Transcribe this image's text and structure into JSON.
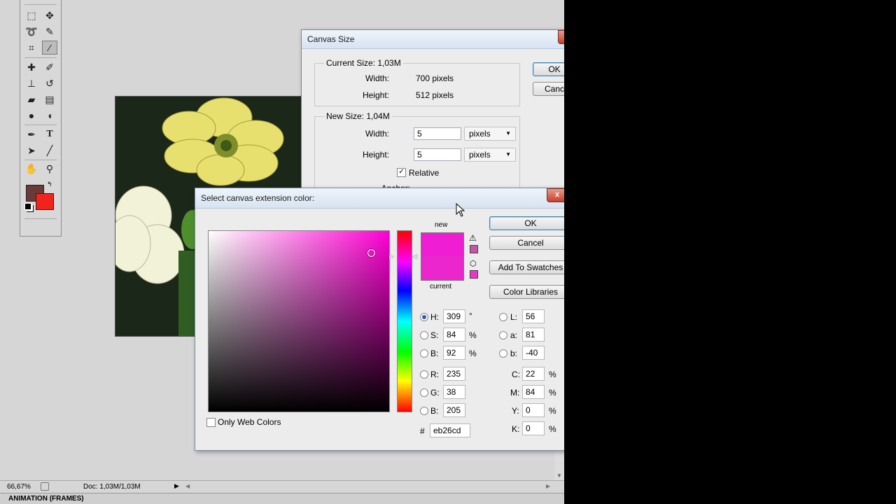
{
  "toolbox": {
    "tools": [
      "marquee-icon",
      "move-icon",
      "lasso-icon",
      "quick-selection-icon",
      "crop-icon",
      "eyedropper-icon",
      "spot-healing-icon",
      "brush-icon",
      "clone-stamp-icon",
      "history-brush-icon",
      "eraser-icon",
      "gradient-icon",
      "blur-icon",
      "dodge-icon",
      "pen-icon",
      "type-icon",
      "path-selection-icon",
      "line-icon",
      "hand-icon",
      "zoom-icon"
    ],
    "foreground_color": "#6a3a38",
    "background_color": "#f0241c"
  },
  "status": {
    "zoom": "66,67%",
    "doc": "Doc: 1,03M/1,03M",
    "panel": "ANIMATION (FRAMES)"
  },
  "canvas_size": {
    "title": "Canvas Size",
    "current_label": "Current Size: 1,03M",
    "width_label": "Width:",
    "width_value": "700 pixels",
    "height_label": "Height:",
    "height_value": "512 pixels",
    "new_label": "New Size: 1,04M",
    "new_width_label": "Width:",
    "new_width": "5",
    "new_width_unit": "pixels",
    "new_height_label": "Height:",
    "new_height": "5",
    "new_height_unit": "pixels",
    "relative_label": "Relative",
    "anchor_label": "Anchor:",
    "ok": "OK",
    "cancel": "Canc"
  },
  "color_picker": {
    "title": "Select canvas extension color:",
    "new_label": "new",
    "current_label": "current",
    "new_color": "#ef1ed5",
    "current_color": "#eb26cd",
    "ok": "OK",
    "cancel": "Cancel",
    "add_swatches": "Add To Swatches",
    "libraries": "Color Libraries",
    "only_web": "Only Web Colors",
    "fields": {
      "H": "309",
      "H_unit": "°",
      "S": "84",
      "S_unit": "%",
      "B": "92",
      "B_unit": "%",
      "R": "235",
      "G": "38",
      "Bl": "205",
      "L": "56",
      "a": "81",
      "b": "-40",
      "C": "22",
      "M": "84",
      "Y": "0",
      "K": "0",
      "pct": "%",
      "hash": "#",
      "hex": "eb26cd"
    },
    "labels": {
      "H": "H:",
      "S": "S:",
      "B": "B:",
      "R": "R:",
      "G": "G:",
      "Bl": "B:",
      "L": "L:",
      "a": "a:",
      "b": "b:",
      "C": "C:",
      "M": "M:",
      "Y": "Y:",
      "K": "K:"
    }
  }
}
